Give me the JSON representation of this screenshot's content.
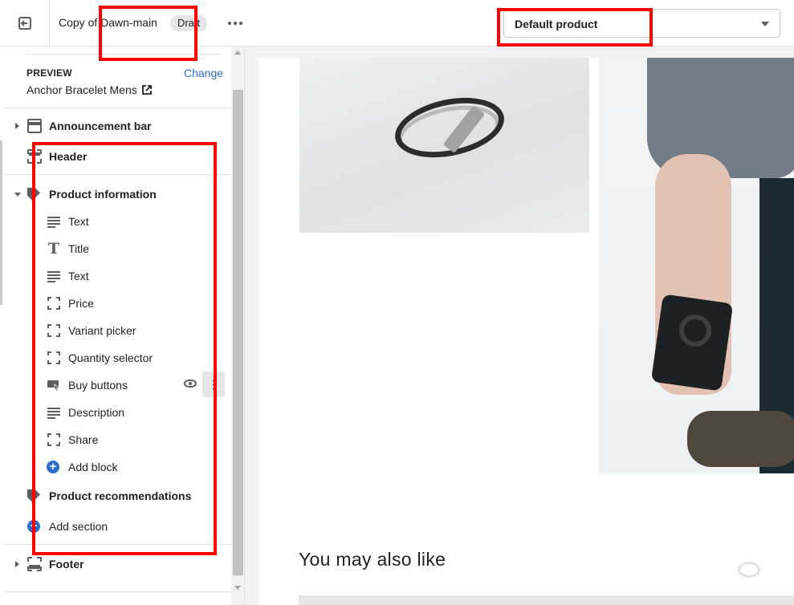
{
  "topbar": {
    "theme_name": "Copy of Dawn-main",
    "badge": "Draft",
    "template_select": "Default product"
  },
  "sidebar": {
    "preview_label": "PREVIEW",
    "change_label": "Change",
    "preview_product": "Anchor Bracelet Mens",
    "sections": {
      "announcement": "Announcement bar",
      "header": "Header",
      "product_information": "Product information",
      "product_recommendations": "Product recommendations",
      "footer": "Footer"
    },
    "blocks": [
      "Text",
      "Title",
      "Text",
      "Price",
      "Variant picker",
      "Quantity selector",
      "Buy buttons",
      "Description",
      "Share"
    ],
    "add_block": "Add block",
    "add_section": "Add section"
  },
  "preview": {
    "heading": "You may also like"
  },
  "colors": {
    "accent": "#2c6ecb",
    "annotation": "#ff0000"
  }
}
